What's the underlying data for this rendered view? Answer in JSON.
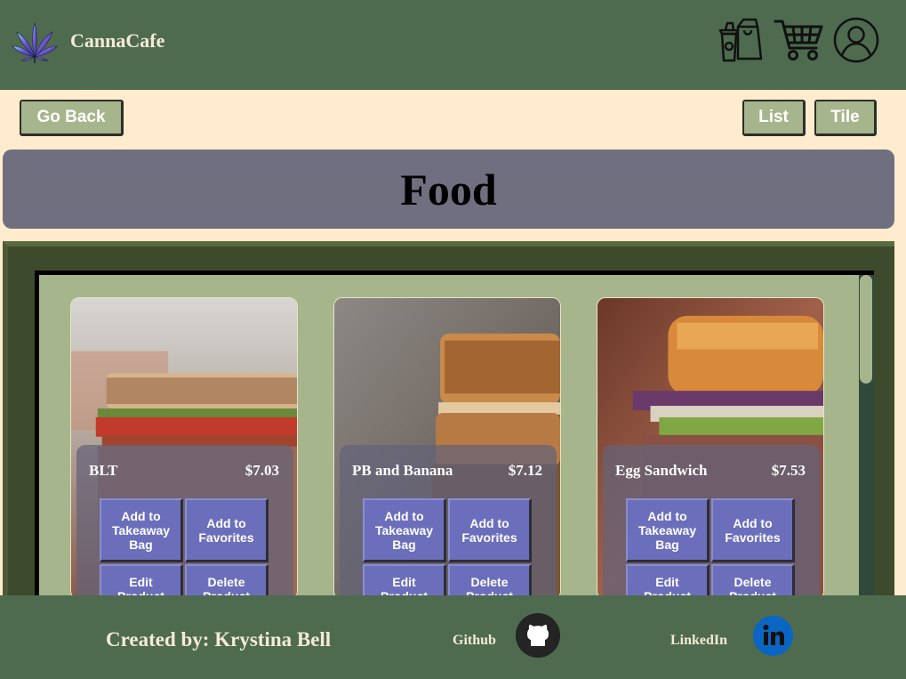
{
  "header": {
    "brand": "CannaCafe",
    "icons": [
      "cannabis-logo-icon",
      "takeaway-bag-icon",
      "shopping-cart-icon",
      "user-profile-icon"
    ]
  },
  "nav": {
    "back_label": "Go Back",
    "list_label": "List",
    "tile_label": "Tile"
  },
  "page": {
    "title": "Food"
  },
  "products": [
    {
      "name": "BLT",
      "price": "$7.03",
      "add_bag_label": "Add to Takeaway Bag",
      "add_fav_label": "Add to Favorites",
      "edit_label": "Edit Product",
      "delete_label": "Delete Product"
    },
    {
      "name": "PB and Banana",
      "price": "$7.12",
      "add_bag_label": "Add to Takeaway Bag",
      "add_fav_label": "Add to Favorites",
      "edit_label": "Edit Product",
      "delete_label": "Delete Product"
    },
    {
      "name": "Egg Sandwich",
      "price": "$7.53",
      "add_bag_label": "Add to Takeaway Bag",
      "add_fav_label": "Add to Favorites",
      "edit_label": "Edit Product",
      "delete_label": "Delete Product"
    }
  ],
  "footer": {
    "credit": "Created by: Krystina Bell",
    "github_label": "Github",
    "linkedin_label": "LinkedIn"
  },
  "colors": {
    "header_green": "#4e6b4f",
    "cream": "#ffebcd",
    "sage": "#a6b58b",
    "banner_gray": "#706f80",
    "button_purple": "#6b6fbb",
    "linkedin_blue": "#0a66c2"
  }
}
